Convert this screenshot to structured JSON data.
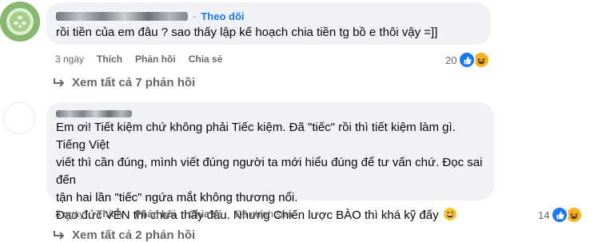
{
  "comments": [
    {
      "follow_label": "Theo dõi",
      "text": "rồi tiền của em đâu ? sao thấy lập kế hoạch chia tiền tg bồ e thôi vậy =]]",
      "time": "3 ngày",
      "like_label": "Thích",
      "reply_label": "Phản hồi",
      "share_label": "Chia sẻ",
      "reaction_count": "20",
      "reactions": [
        "like-icon",
        "haha-icon"
      ],
      "view_replies": "Xem tất cả 7 phản hồi"
    },
    {
      "text_lines": [
        "Em ơi! Tiết kiệm chứ không phải Tiếc kiệm. Đã \"tiếc\" rồi thì tiết kiệm làm gì. Tiếng Việt",
        "viết thì cần đúng, mình viết đúng người ta mới hiểu đúng để tư vấn chứ. Đọc sai đến",
        "tận hai lần \"tiếc\" ngứa mắt không thương nổi.",
        "Đạo đức VÉN thì chưa thấy đâu. Nhưng Chiến lược BÀO thì khá kỹ đấy"
      ],
      "time": "3 ngày",
      "like_label": "Thích",
      "reply_label": "Phản hồi",
      "share_label": "Chia sẻ",
      "edited_label": "Đã chỉnh sửa",
      "reaction_count": "14",
      "reactions": [
        "like-icon",
        "haha-icon"
      ],
      "view_replies": "Xem tất cả 2 phản hồi"
    }
  ],
  "colors": {
    "bubble": "#f0f2f5",
    "link_blue": "#1877f2",
    "secondary_text": "#65676b"
  }
}
